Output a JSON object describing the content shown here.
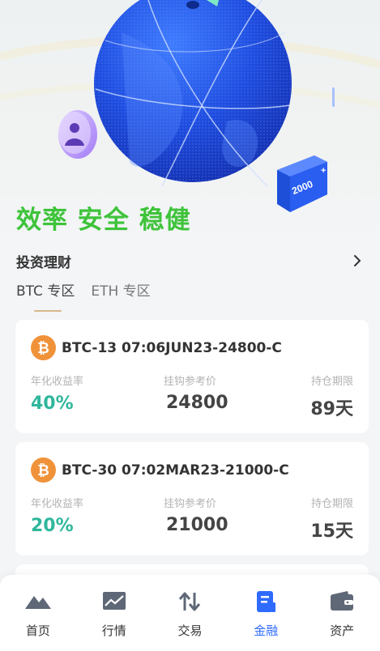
{
  "hero": {
    "slogan": "效率 安全 稳健",
    "badge_text": "2000"
  },
  "section": {
    "title": "投资理财"
  },
  "tabs": [
    {
      "label": "BTC 专区",
      "active": true
    },
    {
      "label": "ETH 专区",
      "active": false
    }
  ],
  "column_labels": {
    "rate": "年化收益率",
    "price": "挂钩参考价",
    "term": "持仓期限"
  },
  "products": [
    {
      "name": "BTC-13 07:06JUN23-24800-C",
      "rate": "40%",
      "price": "24800",
      "term": "89天",
      "coin_icon": "bitcoin-icon"
    },
    {
      "name": "BTC-30 07:02MAR23-21000-C",
      "rate": "20%",
      "price": "21000",
      "term": "15天",
      "coin_icon": "bitcoin-icon"
    }
  ],
  "tabbar": [
    {
      "label": "首页",
      "icon": "home-icon",
      "active": false
    },
    {
      "label": "行情",
      "icon": "market-chart-icon",
      "active": false
    },
    {
      "label": "交易",
      "icon": "trade-arrows-icon",
      "active": false
    },
    {
      "label": "金融",
      "icon": "finance-doc-icon",
      "active": true
    },
    {
      "label": "资产",
      "icon": "wallet-icon",
      "active": false
    }
  ],
  "colors": {
    "slogan": "#3ec33a",
    "rate": "#2fb79c",
    "tab_active": "#2f6bff",
    "tab_underline": "#d6b98a",
    "bitcoin": "#f0923a"
  }
}
